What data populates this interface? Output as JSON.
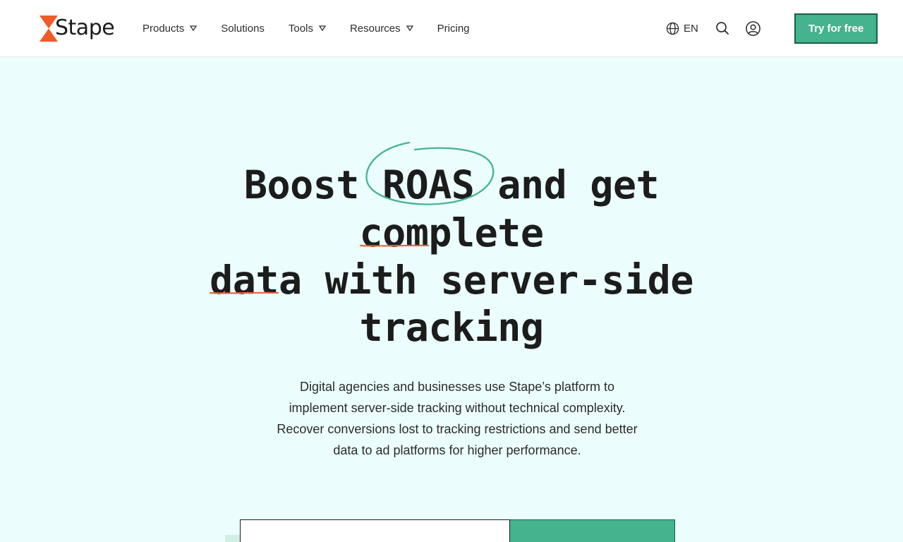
{
  "brand": {
    "name": "Stape",
    "accent": "#44b38e",
    "logo_color": "#f15a29",
    "underline_color": "#e8643b"
  },
  "nav": {
    "items": [
      {
        "label": "Products",
        "has_dropdown": true
      },
      {
        "label": "Solutions",
        "has_dropdown": false
      },
      {
        "label": "Tools",
        "has_dropdown": true
      },
      {
        "label": "Resources",
        "has_dropdown": true
      },
      {
        "label": "Pricing",
        "has_dropdown": false
      }
    ]
  },
  "header": {
    "language": "EN",
    "icons": [
      "globe-icon",
      "search-icon",
      "user-icon"
    ],
    "cta_label": "Try for free"
  },
  "hero": {
    "headline": {
      "w1": "Boost",
      "w2": "ROAS",
      "w3": "and",
      "w4": "get",
      "w5": "complete",
      "w6": "data",
      "w7": "with",
      "w8": "server-side",
      "w9": "tracking"
    },
    "subtitle": "Digital agencies and businesses use Stape’s platform to implement server-side tracking without technical complexity. Recover conversions lost to tracking restrictions and send better data to ad platforms for higher performance.",
    "email_input": {
      "value": "",
      "placeholder": ""
    }
  }
}
